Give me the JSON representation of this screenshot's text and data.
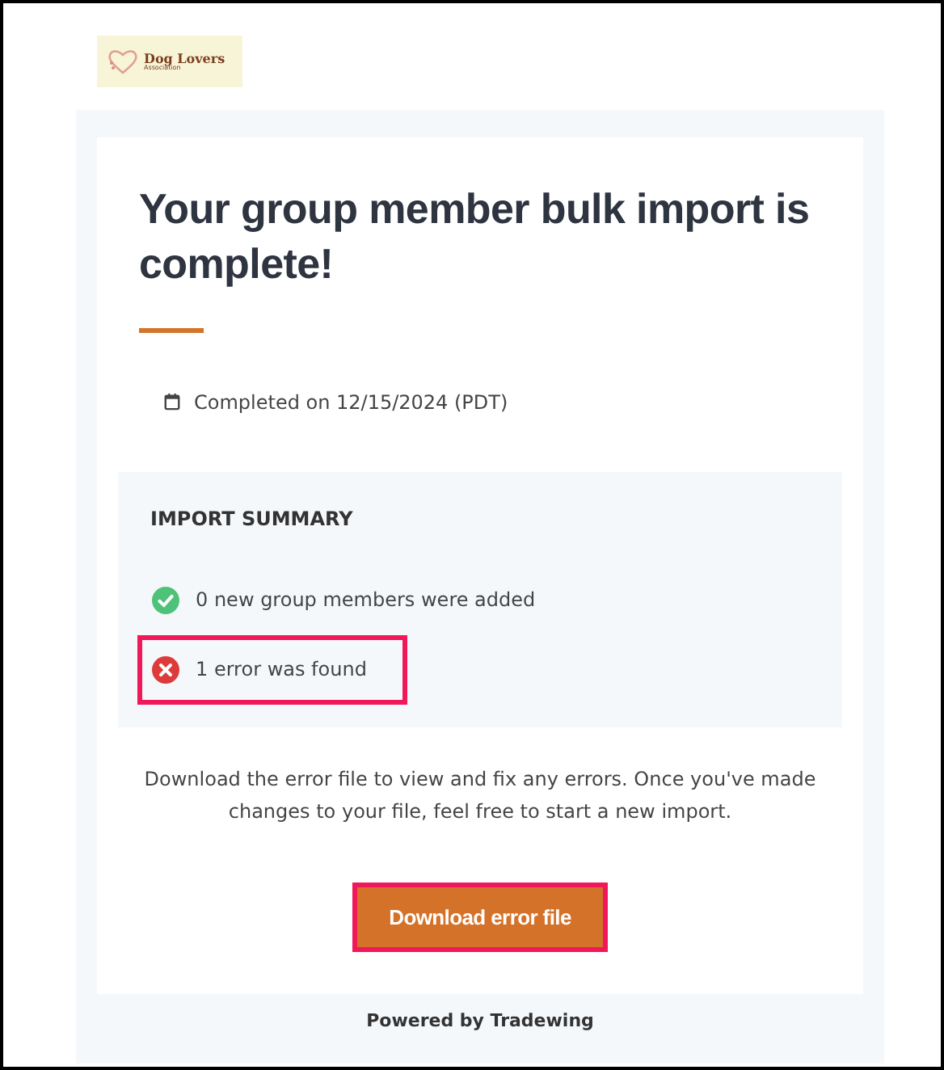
{
  "logo": {
    "title": "Dog Lovers",
    "subtitle": "Association"
  },
  "heading": "Your group member bulk import is complete!",
  "completed": "Completed on 12/15/2024 (PDT)",
  "summary": {
    "title": "IMPORT SUMMARY",
    "items": [
      {
        "kind": "success",
        "text": "0 new group members were added",
        "highlighted": false
      },
      {
        "kind": "error",
        "text": "1 error was found",
        "highlighted": true
      }
    ]
  },
  "message": "Download the error file to view and fix any errors. Once you've made changes to your file, feel free to start a new import.",
  "button": {
    "label": "Download error file",
    "highlighted": true
  },
  "footer": "Powered by Tradewing"
}
